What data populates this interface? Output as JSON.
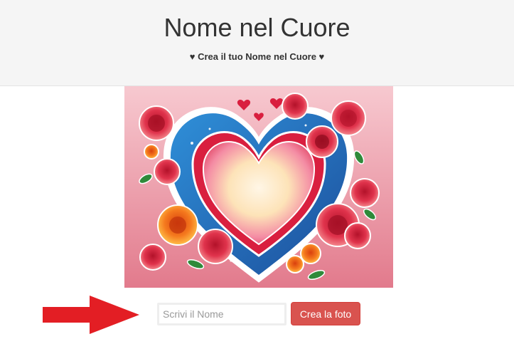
{
  "header": {
    "title": "Nome nel Cuore",
    "subtitle": "♥ Crea il tuo Nome nel Cuore ♥"
  },
  "hero": {
    "image_description_icon": "heart-with-roses-image"
  },
  "form": {
    "name_placeholder": "Scrivi il Nome",
    "name_value": "",
    "submit_label": "Crea la foto"
  },
  "colors": {
    "header_bg": "#f5f5f5",
    "button_bg": "#d9534f",
    "arrow": "#e31e24"
  },
  "icons": {
    "pointer": "red-arrow-icon"
  }
}
